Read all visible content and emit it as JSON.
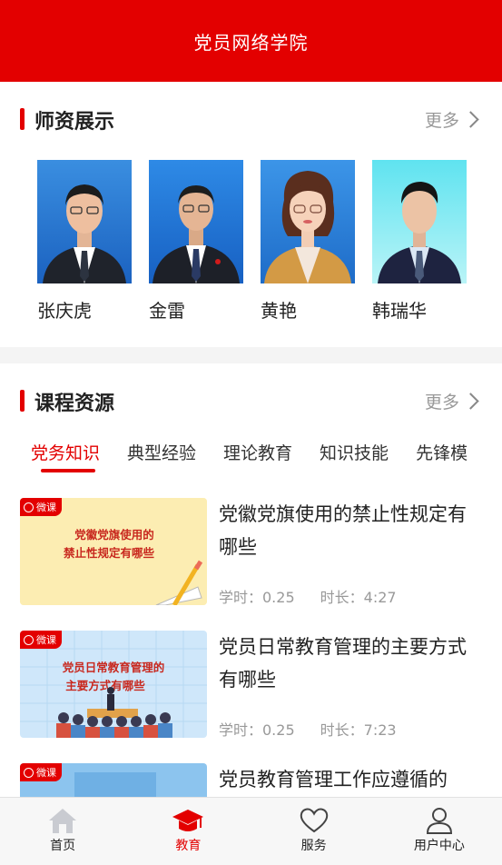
{
  "header": {
    "title": "党员网络学院"
  },
  "teachers_section": {
    "title": "师资展示",
    "more": "更多",
    "teachers": [
      {
        "name": "张庆虎"
      },
      {
        "name": "金雷"
      },
      {
        "name": "黄艳"
      },
      {
        "name": "韩瑞华"
      }
    ]
  },
  "courses_section": {
    "title": "课程资源",
    "more": "更多",
    "tabs": [
      "党务知识",
      "典型经验",
      "理论教育",
      "知识技能",
      "先锋模"
    ],
    "active_tab": 0,
    "courses": [
      {
        "badge": "微课",
        "thumb_text": [
          "党徽党旗使用的",
          "禁止性规定有哪些"
        ],
        "title": "党徽党旗使用的禁止性规定有哪些",
        "hours_label": "学时：0.25",
        "duration_label": "时长：4:27"
      },
      {
        "badge": "微课",
        "thumb_text": [
          "党员日常教育管理的",
          "主要方式有哪些"
        ],
        "title": "党员日常教育管理的主要方式有哪些",
        "hours_label": "学时：0.25",
        "duration_label": "时长：7:23"
      },
      {
        "badge": "微课",
        "thumb_text": [],
        "title": "党员教育管理工作应遵循的",
        "hours_label": "",
        "duration_label": ""
      }
    ]
  },
  "bottom_nav": {
    "items": [
      {
        "label": "首页",
        "icon": "home-icon"
      },
      {
        "label": "教育",
        "icon": "graduation-cap-icon"
      },
      {
        "label": "服务",
        "icon": "heart-icon"
      },
      {
        "label": "用户中心",
        "icon": "user-icon"
      }
    ],
    "active": 1
  },
  "colors": {
    "accent": "#e30000",
    "muted": "#999999"
  }
}
